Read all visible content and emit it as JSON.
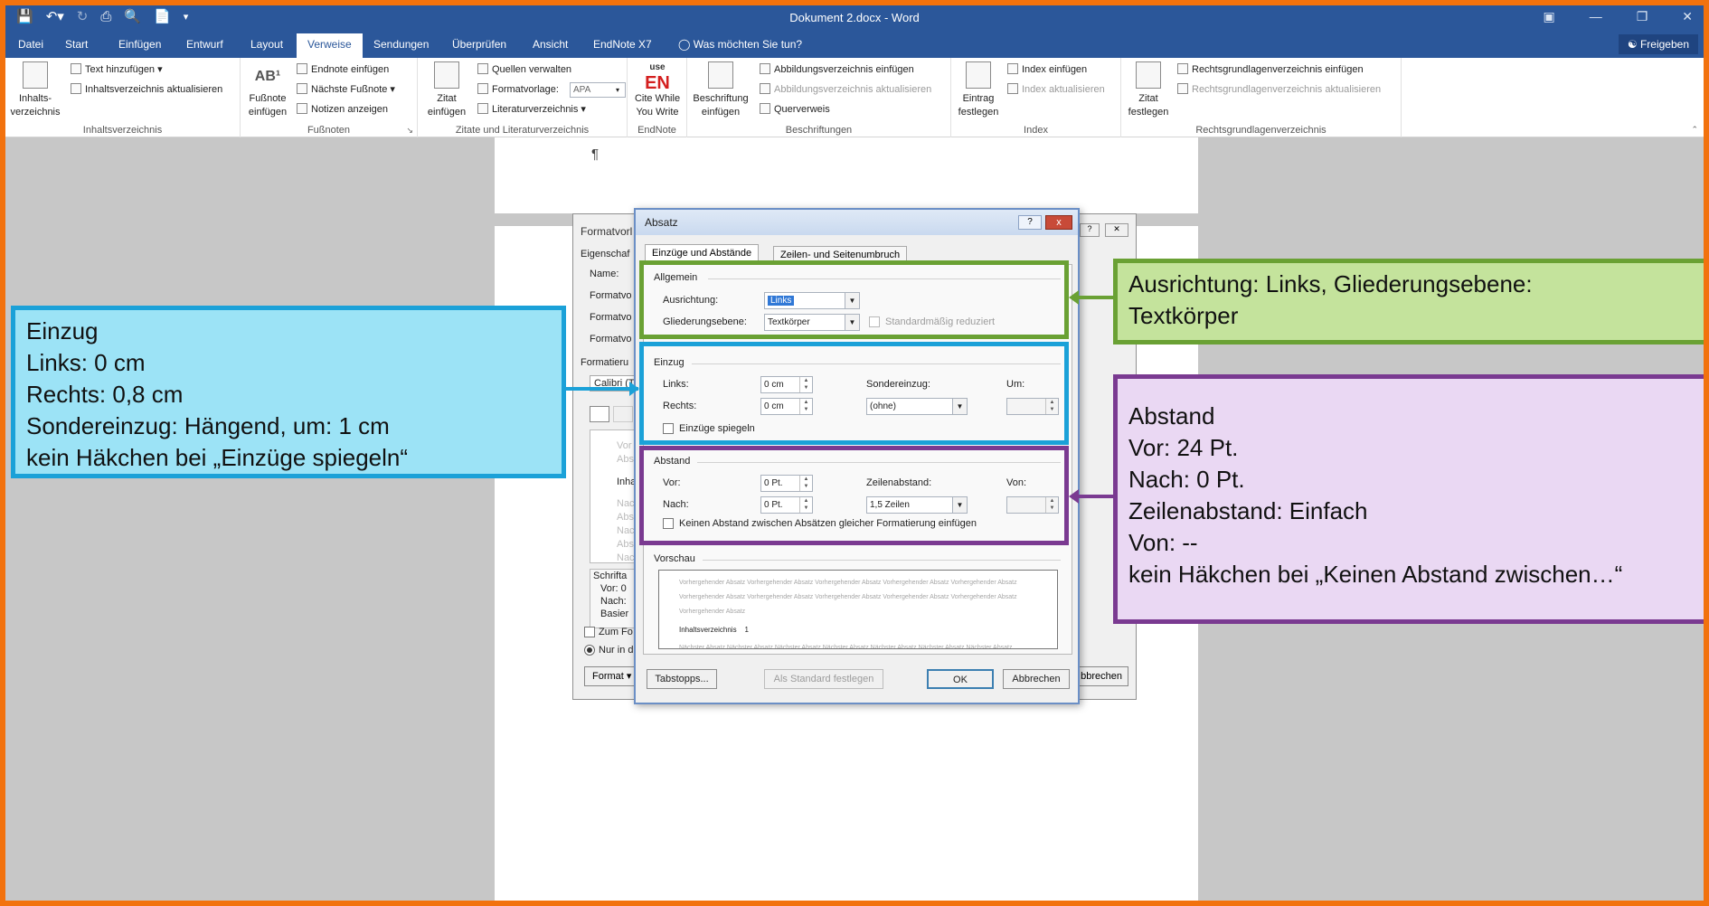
{
  "titlebar": {
    "title": "Dokument 2.docx - Word"
  },
  "qat_icons": [
    "save-icon",
    "undo-icon",
    "redo-icon",
    "quick-print-icon",
    "print-preview-icon",
    "new-document-icon",
    "customize-qat-icon"
  ],
  "tabs": [
    "Datei",
    "Start",
    "Einfügen",
    "Entwurf",
    "Layout",
    "Verweise",
    "Sendungen",
    "Überprüfen",
    "Ansicht",
    "EndNote X7"
  ],
  "active_tab": "Verweise",
  "tell_me": "Was möchten Sie tun?",
  "share": "Freigeben",
  "ribbon": {
    "toc": {
      "big_label": "Inhalts-\nverzeichnis",
      "add_text": "Text hinzufügen",
      "update": "Inhaltsverzeichnis aktualisieren",
      "group": "Inhaltsverzeichnis"
    },
    "footnotes": {
      "big_label": "Fußnote\neinfügen",
      "ab_glyph": "AB¹",
      "endnote": "Endnote einfügen",
      "next": "Nächste Fußnote",
      "show": "Notizen anzeigen",
      "group": "Fußnoten"
    },
    "citations": {
      "big_label": "Zitat\neinfügen",
      "manage": "Quellen verwalten",
      "style_label": "Formatvorlage:",
      "style_value": "APA",
      "bibliography": "Literaturverzeichnis",
      "group": "Zitate und Literaturverzeichnis"
    },
    "endnote": {
      "logo_top": "use",
      "logo_main": "EN",
      "big_label": "Cite While\nYou Write",
      "group": "EndNote"
    },
    "captions": {
      "big_label": "Beschriftung\neinfügen",
      "insert_tof": "Abbildungsverzeichnis einfügen",
      "update_tof": "Abbildungsverzeichnis aktualisieren",
      "crossref": "Querverweis",
      "group": "Beschriftungen"
    },
    "index": {
      "big_label": "Eintrag\nfestlegen",
      "insert": "Index einfügen",
      "update": "Index aktualisieren",
      "group": "Index"
    },
    "authorities": {
      "big_label": "Zitat\nfestlegen",
      "insert": "Rechtsgrundlagenverzeichnis einfügen",
      "update": "Rechtsgrundlagenverzeichnis aktualisieren",
      "group": "Rechtsgrundlagenverzeichnis"
    }
  },
  "document": {
    "pilcrow": "¶"
  },
  "bg_dialog": {
    "title": "Formatvorl",
    "properties": "Eigenschaf",
    "name": "Name:",
    "rows": [
      "Formatvo",
      "Formatvo",
      "Formatvo"
    ],
    "formatting": "Formatieru",
    "font": "Calibri (T",
    "preview_lines": [
      "Vor",
      "Abs",
      "Inha",
      "Nac",
      "Abs",
      "Nac",
      "Abs",
      "Nac"
    ],
    "desc": [
      "Schrifta",
      "Vor: 0",
      "Nach:",
      "Basier"
    ],
    "check_template": "Zum Fo",
    "radio_doc": "Nur in d",
    "format_btn": "Format",
    "cancel_btn": "bbrechen"
  },
  "dialog": {
    "title": "Absatz",
    "help": "?",
    "close": "x",
    "tabs": [
      "Einzüge und Abstände",
      "Zeilen- und Seitenumbruch"
    ],
    "general": {
      "header": "Allgemein",
      "alignment_label": "Ausrichtung:",
      "alignment_value": "Links",
      "outline_label": "Gliederungsebene:",
      "outline_value": "Textkörper",
      "collapsed_label": "Standardmäßig reduziert"
    },
    "indent": {
      "header": "Einzug",
      "left_label": "Links:",
      "left_value": "0 cm",
      "right_label": "Rechts:",
      "right_value": "0 cm",
      "special_label": "Sondereinzug:",
      "special_value": "(ohne)",
      "by_label": "Um:",
      "by_value": "",
      "mirror_label": "Einzüge spiegeln"
    },
    "spacing": {
      "header": "Abstand",
      "before_label": "Vor:",
      "before_value": "0 Pt.",
      "after_label": "Nach:",
      "after_value": "0 Pt.",
      "line_label": "Zeilenabstand:",
      "line_value": "1,5 Zeilen",
      "at_label": "Von:",
      "at_value": "",
      "no_space_label": "Keinen Abstand zwischen Absätzen gleicher Formatierung einfügen"
    },
    "preview": {
      "header": "Vorschau",
      "prev_lines": [
        "Vorhergehender Absatz Vorhergehender Absatz Vorhergehender Absatz Vorhergehender Absatz Vorhergehender Absatz",
        "Vorhergehender Absatz Vorhergehender Absatz Vorhergehender Absatz Vorhergehender Absatz Vorhergehender Absatz",
        "Vorhergehender Absatz"
      ],
      "main": "Inhaltsverzeichnis    1",
      "next_line": "Nächster Absatz Nächster Absatz Nächster Absatz Nächster Absatz Nächster Absatz Nächster Absatz Nächster Absatz"
    },
    "buttons": {
      "tabs": "Tabstopps...",
      "default": "Als Standard festlegen",
      "ok": "OK",
      "cancel": "Abbrechen"
    }
  },
  "annotations": {
    "indent": [
      "Einzug",
      "Links: 0 cm",
      "Rechts: 0,8 cm",
      "Sondereinzug: Hängend, um: 1 cm",
      "kein Häkchen bei „Einzüge spiegeln“"
    ],
    "general": [
      "Ausrichtung: Links, Gliederungsebene:",
      "Textkörper"
    ],
    "spacing": [
      "Abstand",
      "Vor: 24 Pt.",
      "Nach: 0 Pt.",
      "Zeilenabstand: Einfach",
      "Von: --",
      "kein Häkchen bei „Keinen Abstand zwischen…“"
    ]
  },
  "colors": {
    "frame": "#f2720e",
    "word_blue": "#2b579a",
    "green": "#6aa134",
    "green_fill": "#c4e39c",
    "cyan": "#1ba1d8",
    "cyan_fill": "#9ce3f6",
    "purple": "#7a3a91",
    "purple_fill": "#ead8f3"
  }
}
